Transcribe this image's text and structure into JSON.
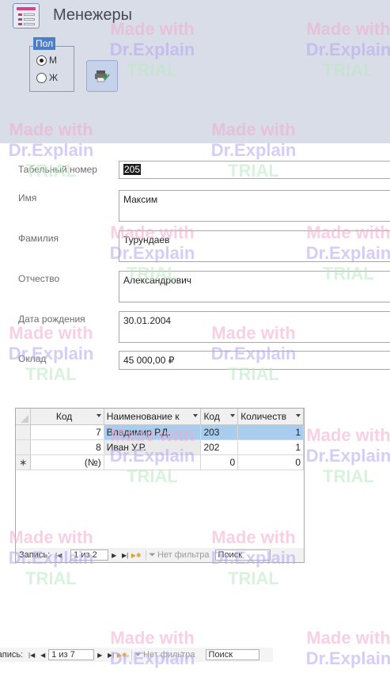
{
  "form": {
    "title": "Менежеры"
  },
  "gender_group": {
    "label": "Пол",
    "options": [
      {
        "label": "М",
        "selected": true
      },
      {
        "label": "Ж",
        "selected": false
      }
    ]
  },
  "fields": [
    {
      "label": "Табельный номер",
      "value": "205"
    },
    {
      "label": "Имя",
      "value": "Максим"
    },
    {
      "label": "Фамилия",
      "value": "Турундаев"
    },
    {
      "label": "Отчество",
      "value": "Александрович"
    },
    {
      "label": "Дата рождения",
      "value": "30.01.2004"
    },
    {
      "label": "Оклад",
      "value": "45 000,00 ₽"
    }
  ],
  "subform": {
    "columns": [
      "Код",
      "Наименование к",
      "Код",
      "Количеств"
    ],
    "rows": [
      {
        "col1": "7",
        "col2": "Владимир Р.Д.",
        "col3": "203",
        "col4": "1"
      },
      {
        "col1": "8",
        "col2": "Иван У.Р.",
        "col3": "202",
        "col4": "1"
      },
      {
        "col1": "(№)",
        "col2": "",
        "col3": "0",
        "col4": "0"
      }
    ],
    "new_row_marker": "∗",
    "nav": {
      "record_label": "Запись:",
      "position": "1 из 2",
      "filter_label": "Нет фильтра",
      "search_label": "Поиск"
    }
  },
  "main_nav": {
    "record_label": "Запись:",
    "position": "1 из 7",
    "filter_label": "Нет фильтра",
    "search_label": "Поиск"
  },
  "watermark": {
    "line1": "Made with",
    "line2": "Dr.Explain",
    "line3": "TRIAL"
  },
  "colors": {
    "header_bg": "#d9dde7",
    "selection": "#a9cdef",
    "group_label_bg": "#4b7fc9"
  }
}
